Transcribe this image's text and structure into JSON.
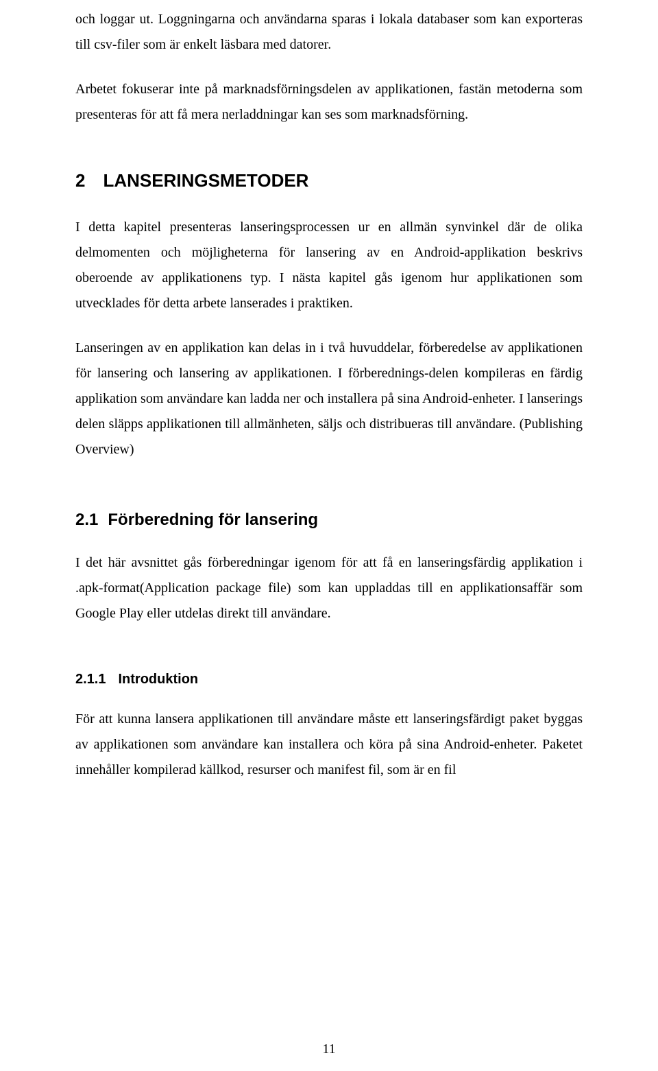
{
  "paragraphs": {
    "intro1": "och loggar ut. Loggningarna och användarna sparas i lokala databaser som kan exporteras till csv-filer som är enkelt läsbara med datorer.",
    "intro2": "Arbetet fokuserar inte på marknadsförningsdelen av applikationen, fastän metoderna som presenteras för att få mera nerladdningar kan ses som marknadsförning.",
    "chapter2_p1": "I detta kapitel presenteras lanseringsprocessen ur en allmän synvinkel där de olika delmomenten och möjligheterna för lansering av en Android-applikation beskrivs oberoende av applikationens typ. I nästa kapitel gås igenom hur applikationen som utvecklades för detta arbete lanserades i praktiken.",
    "chapter2_p2": "Lanseringen av en applikation kan delas in i två huvuddelar, förberedelse av applikationen för lansering och lansering av applikationen. I förberednings-delen kompileras en färdig applikation som användare kan ladda ner och installera på sina Android-enheter. I lanserings delen släpps applikationen till allmänheten, säljs och distribueras till användare. (Publishing Overview)",
    "section21_p1": "I det här avsnittet gås förberedningar igenom för att få en lanseringsfärdig applikation i .apk-format(Application package file) som kan uppladdas till en applikationsaffär som Google Play eller utdelas direkt till användare.",
    "sub211_p1": "För att kunna lansera applikationen till användare måste ett lanseringsfärdigt paket byggas av applikationen som användare kan installera och köra på sina Android-enheter. Paketet innehåller kompilerad källkod, resurser och manifest fil, som är en fil"
  },
  "headings": {
    "chapter2_num": "2",
    "chapter2_title": "LANSERINGSMETODER",
    "section21_num": "2.1",
    "section21_title": "Förberedning för lansering",
    "sub211_num": "2.1.1",
    "sub211_title": "Introduktion"
  },
  "page_number": "11"
}
